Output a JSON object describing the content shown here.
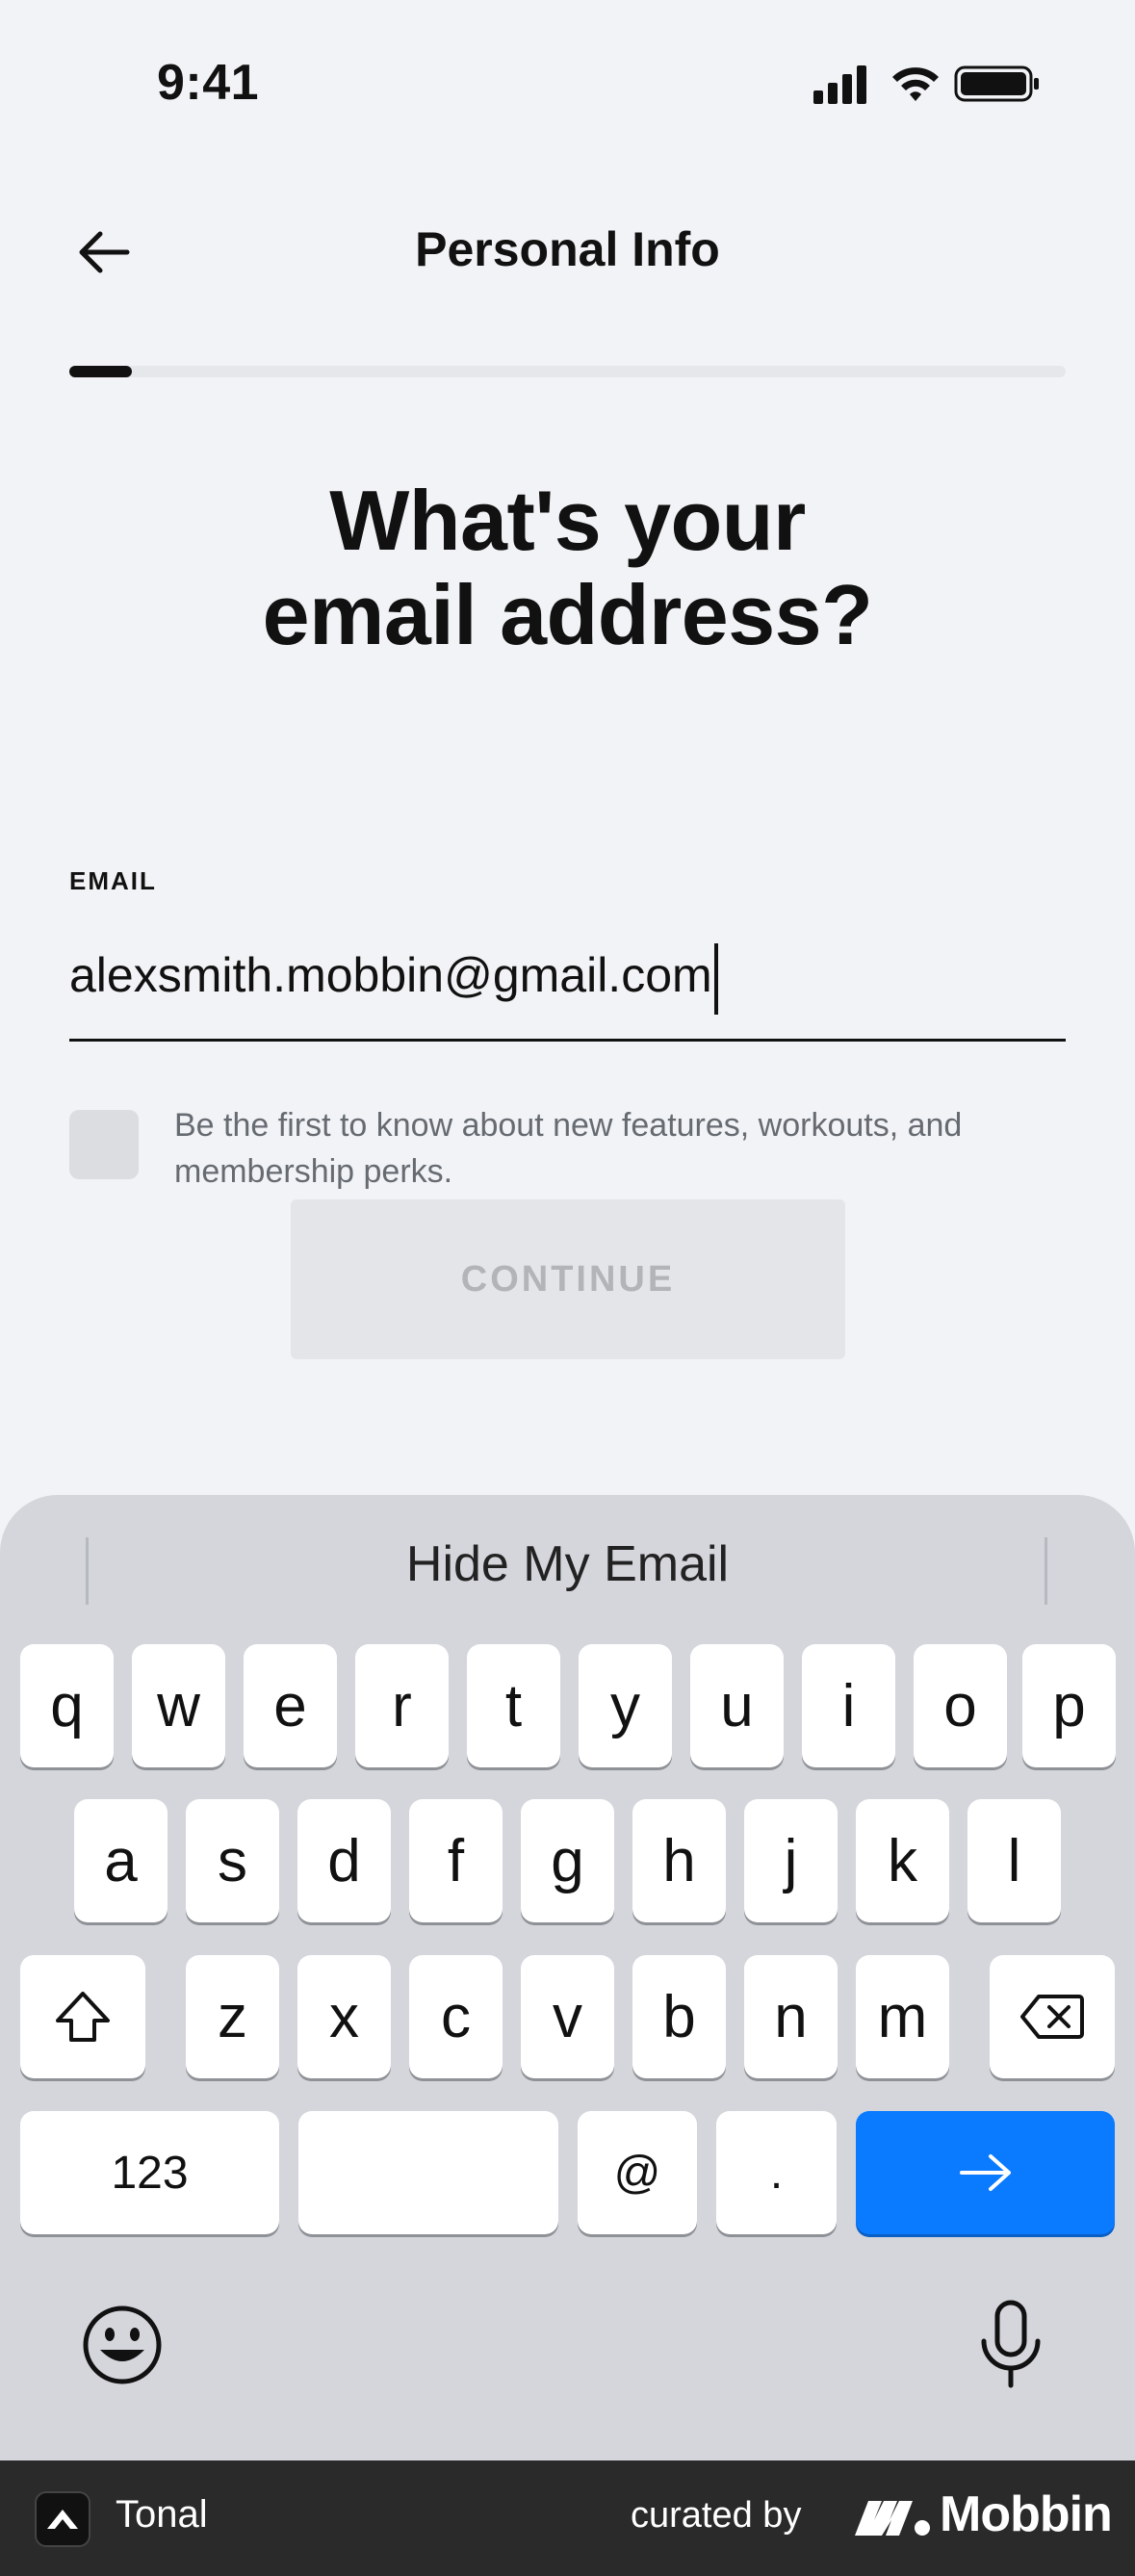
{
  "status_bar": {
    "time": "9:41"
  },
  "header": {
    "title": "Personal Info"
  },
  "progress": {
    "fraction": 0.063
  },
  "question": {
    "line1": "What's your",
    "line2": "email address?"
  },
  "email": {
    "label": "EMAIL",
    "value": "alexsmith.mobbin@gmail.com"
  },
  "opt_in": {
    "text": "Be the first to know about new features, workouts, and membership perks.",
    "checked": false
  },
  "continue": {
    "label": "CONTINUE"
  },
  "keyboard": {
    "suggestion": "Hide My Email",
    "row1": [
      "q",
      "w",
      "e",
      "r",
      "t",
      "y",
      "u",
      "i",
      "o",
      "p"
    ],
    "row2": [
      "a",
      "s",
      "d",
      "f",
      "g",
      "h",
      "j",
      "k",
      "l"
    ],
    "row3": [
      "z",
      "x",
      "c",
      "v",
      "b",
      "n",
      "m"
    ],
    "numbers_label": "123",
    "at_label": "@",
    "dot_label": "."
  },
  "branding": {
    "app_name": "Tonal",
    "curated_by": "curated by",
    "mobbin": "Mobbin"
  },
  "colors": {
    "accent": "#0a7aff",
    "background": "#f2f3f6",
    "keyboard": "#d4d6dc"
  }
}
